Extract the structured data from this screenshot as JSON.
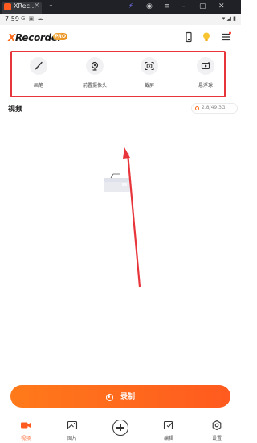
{
  "emulator": {
    "tab_label": "XRec…",
    "close_glyph": "×",
    "chevron_glyph": "⌄"
  },
  "status_bar": {
    "time": "7:59",
    "left_icons": "G ▣ ☁",
    "right_icons": "▾ ◢ ▮"
  },
  "header": {
    "logo_accent": "X",
    "logo_rest": "Recorder",
    "pro_badge": "PRO"
  },
  "floating_menu": [
    {
      "id": "brush",
      "label": "画笔",
      "icon": "brush-icon"
    },
    {
      "id": "front-camera",
      "label": "前置摄像头",
      "icon": "webcam-icon"
    },
    {
      "id": "screenshot",
      "label": "截屏",
      "icon": "screenshot-icon"
    },
    {
      "id": "floating-ball",
      "label": "悬浮球",
      "icon": "floating-ball-icon"
    }
  ],
  "section": {
    "title": "视频",
    "storage": "2.8/49.3G"
  },
  "record_button": {
    "label": "录制"
  },
  "bottom_nav": [
    {
      "id": "video",
      "label": "视频",
      "icon": "video-icon",
      "active": true
    },
    {
      "id": "images",
      "label": "图片",
      "icon": "image-icon",
      "active": false
    },
    {
      "id": "edit",
      "label": "编辑",
      "icon": "edit-icon",
      "active": false
    },
    {
      "id": "settings",
      "label": "设置",
      "icon": "settings-icon",
      "active": false
    }
  ],
  "colors": {
    "accent": "#ff5a1f",
    "highlight_border": "#e8353b",
    "annotation_arrow": "#e8353b"
  }
}
